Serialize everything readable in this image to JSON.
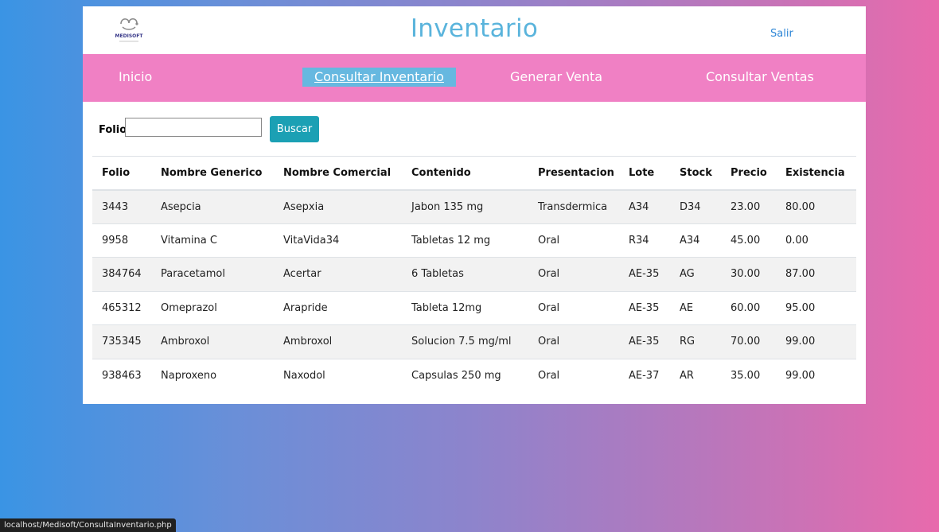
{
  "header": {
    "title": "Inventario",
    "logout_label": "Salir",
    "logo_text": "MEDISOFT"
  },
  "nav": {
    "items": [
      {
        "label": "Inicio"
      },
      {
        "label": "Consultar Inventario"
      },
      {
        "label": "Generar Venta"
      },
      {
        "label": "Consultar Ventas"
      }
    ]
  },
  "search": {
    "label": "Folio:",
    "value": "",
    "placeholder": "",
    "button_label": "Buscar"
  },
  "table": {
    "columns": [
      "Folio",
      "Nombre Generico",
      "Nombre Comercial",
      "Contenido",
      "Presentacion",
      "Lote",
      "Stock",
      "Precio",
      "Existencia"
    ],
    "rows": [
      [
        "3443",
        "Asepcia",
        "Asepxia",
        "Jabon 135 mg",
        "Transdermica",
        "A34",
        "D34",
        "23.00",
        "80.00"
      ],
      [
        "9958",
        "Vitamina C",
        "VitaVida34",
        "Tabletas 12 mg",
        "Oral",
        "R34",
        "A34",
        "45.00",
        "0.00"
      ],
      [
        "384764",
        "Paracetamol",
        "Acertar",
        "6 Tabletas",
        "Oral",
        "AE-35",
        "AG",
        "30.00",
        "87.00"
      ],
      [
        "465312",
        "Omeprazol",
        "Arapride",
        "Tableta 12mg",
        "Oral",
        "AE-35",
        "AE",
        "60.00",
        "95.00"
      ],
      [
        "735345",
        "Ambroxol",
        "Ambroxol",
        "Solucion 7.5 mg/ml",
        "Oral",
        "AE-35",
        "RG",
        "70.00",
        "99.00"
      ],
      [
        "938463",
        "Naproxeno",
        "Naxodol",
        "Capsulas 250 mg",
        "Oral",
        "AE-37",
        "AR",
        "35.00",
        "99.00"
      ]
    ]
  },
  "status_bar": {
    "url": "localhost/Medisoft/ConsultaInventario.php"
  },
  "colors": {
    "nav_bg": "#f080c4",
    "nav_active_bg": "#66b8e0",
    "title": "#5ab4dc",
    "button_bg": "#1ba0b4",
    "link": "#2e86d6"
  }
}
